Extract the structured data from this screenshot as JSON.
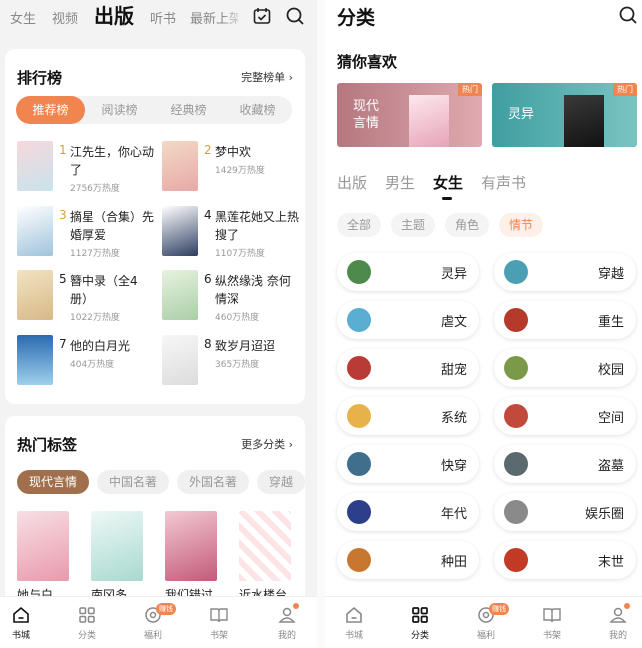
{
  "left": {
    "nav": [
      "女生",
      "视频",
      "出版",
      "听书",
      "最新上架"
    ],
    "rank": {
      "title": "排行榜",
      "more": "完整榜单 ›",
      "tabs": [
        "推荐榜",
        "阅读榜",
        "经典榜",
        "收藏榜"
      ],
      "items": [
        {
          "num": "1",
          "name": "江先生，你心动了",
          "heat": "2756万热度"
        },
        {
          "num": "2",
          "name": "梦中欢",
          "heat": "1429万热度"
        },
        {
          "num": "3",
          "name": "摘星（合集）先婚厚爱",
          "heat": "1127万热度"
        },
        {
          "num": "4",
          "name": "黑莲花她又上热搜了",
          "heat": "1107万热度"
        },
        {
          "num": "5",
          "name": "簪中录（全4册）",
          "heat": "1022万热度"
        },
        {
          "num": "6",
          "name": "纵然缘浅 奈何情深",
          "heat": "460万热度"
        },
        {
          "num": "7",
          "name": "他的白月光",
          "heat": "404万热度"
        },
        {
          "num": "8",
          "name": "致岁月迢迢",
          "heat": "365万热度"
        }
      ]
    },
    "hot": {
      "title": "热门标签",
      "more": "更多分类 ›",
      "chips": [
        "现代言情",
        "中国名著",
        "外国名著",
        "穿越"
      ],
      "books": [
        "她与白",
        "南冈多",
        "我们错过",
        "近水楼台"
      ]
    },
    "tabbar": {
      "tabs": [
        "书城",
        "分类",
        "福利",
        "书架",
        "我的"
      ],
      "badge": "赚钱"
    }
  },
  "right": {
    "title": "分类",
    "sub": "猜你喜欢",
    "banners": [
      {
        "label": "现代\n言情",
        "hot": "热门"
      },
      {
        "label": "灵异",
        "hot": "热门"
      }
    ],
    "gtabs": [
      "出版",
      "男生",
      "女生",
      "有声书"
    ],
    "filters": [
      "全部",
      "主题",
      "角色",
      "情节"
    ],
    "cats": [
      "灵异",
      "穿越",
      "虐文",
      "重生",
      "甜宠",
      "校园",
      "系统",
      "空间",
      "快穿",
      "盗墓",
      "年代",
      "娱乐圈",
      "种田",
      "末世"
    ],
    "tabbar": {
      "tabs": [
        "书城",
        "分类",
        "福利",
        "书架",
        "我的"
      ],
      "badge": "赚钱"
    }
  },
  "colors": {
    "accent": "#f1854f",
    "tag": "#a16f4c"
  }
}
